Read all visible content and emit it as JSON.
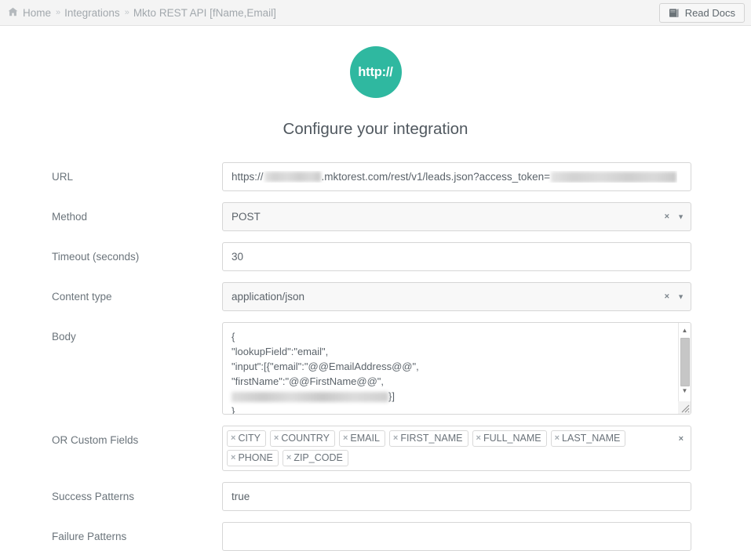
{
  "topbar": {
    "home_label": "Home",
    "separator": "»",
    "crumbs": [
      {
        "label": "Integrations"
      },
      {
        "label": "Mkto REST API [fName,Email]"
      }
    ],
    "read_docs_label": "Read Docs",
    "icons": {
      "home": "home-icon",
      "book": "book-icon"
    }
  },
  "hero": {
    "logo_text": "http://",
    "logo_color": "#2fb8a0",
    "title": "Configure your integration"
  },
  "form": {
    "rows": [
      {
        "label": "URL",
        "type": "url-redacted",
        "url_prefix": "https://",
        "url_middle": ".mktorest.com/rest/v1/leads.json?access_token=",
        "url_suffix": ""
      },
      {
        "label": "Method",
        "type": "select",
        "value": "POST",
        "clear_icon": "×",
        "arrow_icon": "▼"
      },
      {
        "label": "Timeout (seconds)",
        "type": "input",
        "value": "30",
        "placeholder": ""
      },
      {
        "label": "Content type",
        "type": "select",
        "value": "application/json",
        "clear_icon": "×",
        "arrow_icon": "▼"
      },
      {
        "label": "Body",
        "type": "textarea",
        "lines_before": "{\n\"lookupField\":\"email\",\n\"input\":[{\"email\":\"@@EmailAddress@@\",\n\"firstName\":\"@@FirstName@@\",\n",
        "line_after_blur": "}]",
        "last_line": "}"
      },
      {
        "label": "OR Custom Fields",
        "type": "tags",
        "tags": [
          "CITY",
          "COUNTRY",
          "EMAIL",
          "FIRST_NAME",
          "FULL_NAME",
          "LAST_NAME",
          "PHONE",
          "ZIP_CODE"
        ],
        "tag_remove_icon": "×",
        "clear_all_icon": "×"
      },
      {
        "label": "Success Patterns",
        "type": "input",
        "value": "true",
        "placeholder": ""
      },
      {
        "label": "Failure Patterns",
        "type": "input",
        "value": "",
        "placeholder": ""
      }
    ]
  },
  "scrollbar": {
    "up_icon": "▲",
    "down_icon": "▼"
  }
}
